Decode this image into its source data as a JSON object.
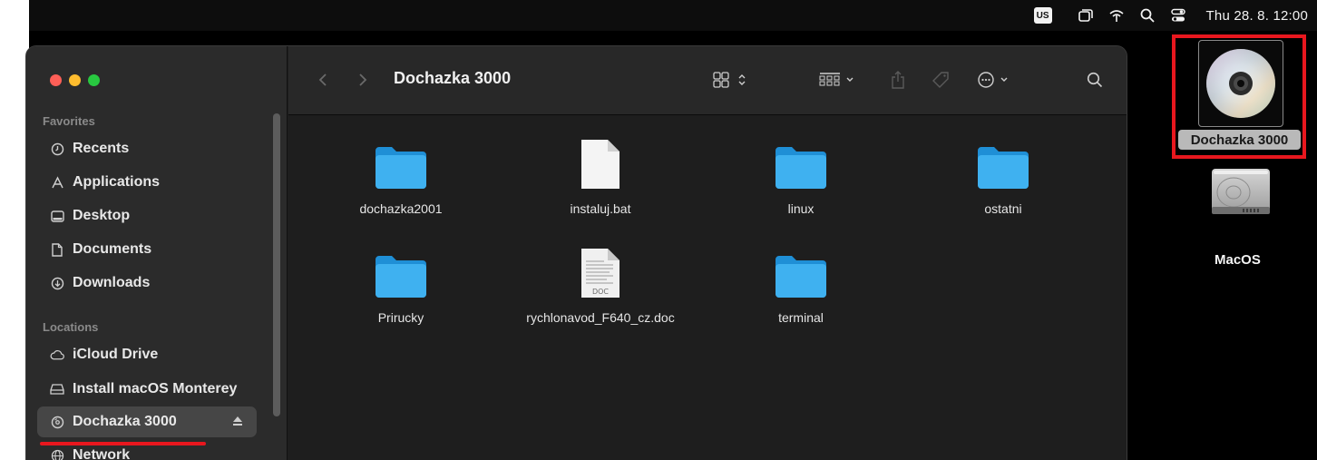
{
  "menubar": {
    "keyboard_layout": "US",
    "clock": "Thu 28. 8.  12:00",
    "icons": [
      "keyboard-layout-icon",
      "window-icon",
      "wifi-icon",
      "spotlight-icon",
      "control-center-icon"
    ]
  },
  "window": {
    "title": "Dochazka 3000"
  },
  "sidebar": {
    "favorites_header": "Favorites",
    "favorites": [
      {
        "label": "Recents",
        "icon": "clock-icon"
      },
      {
        "label": "Applications",
        "icon": "applications-icon"
      },
      {
        "label": "Desktop",
        "icon": "desktop-icon"
      },
      {
        "label": "Documents",
        "icon": "document-icon"
      },
      {
        "label": "Downloads",
        "icon": "download-icon"
      }
    ],
    "locations_header": "Locations",
    "locations": [
      {
        "label": "iCloud Drive",
        "icon": "cloud-icon"
      },
      {
        "label": "Install macOS Monterey",
        "icon": "drive-icon"
      },
      {
        "label": "Dochazka 3000",
        "icon": "disc-icon",
        "selected": true
      },
      {
        "label": "Network",
        "icon": "network-icon"
      }
    ]
  },
  "files": [
    {
      "name": "dochazka2001",
      "kind": "folder"
    },
    {
      "name": "instaluj.bat",
      "kind": "file"
    },
    {
      "name": "linux",
      "kind": "folder"
    },
    {
      "name": "ostatni",
      "kind": "folder"
    },
    {
      "name": "Prirucky",
      "kind": "folder"
    },
    {
      "name": "rychlonavod_F640_cz.doc",
      "kind": "doc",
      "badge": "DOC"
    },
    {
      "name": "terminal",
      "kind": "folder"
    }
  ],
  "desktop": {
    "items": [
      {
        "label": "Dochazka 3000",
        "icon": "cd-disc-icon",
        "selected": true
      },
      {
        "label": "MacOS",
        "icon": "hard-drive-icon"
      }
    ]
  },
  "colors": {
    "folder": "#3fb1f0",
    "highlight": "#e8171e",
    "selection": "#464646"
  }
}
